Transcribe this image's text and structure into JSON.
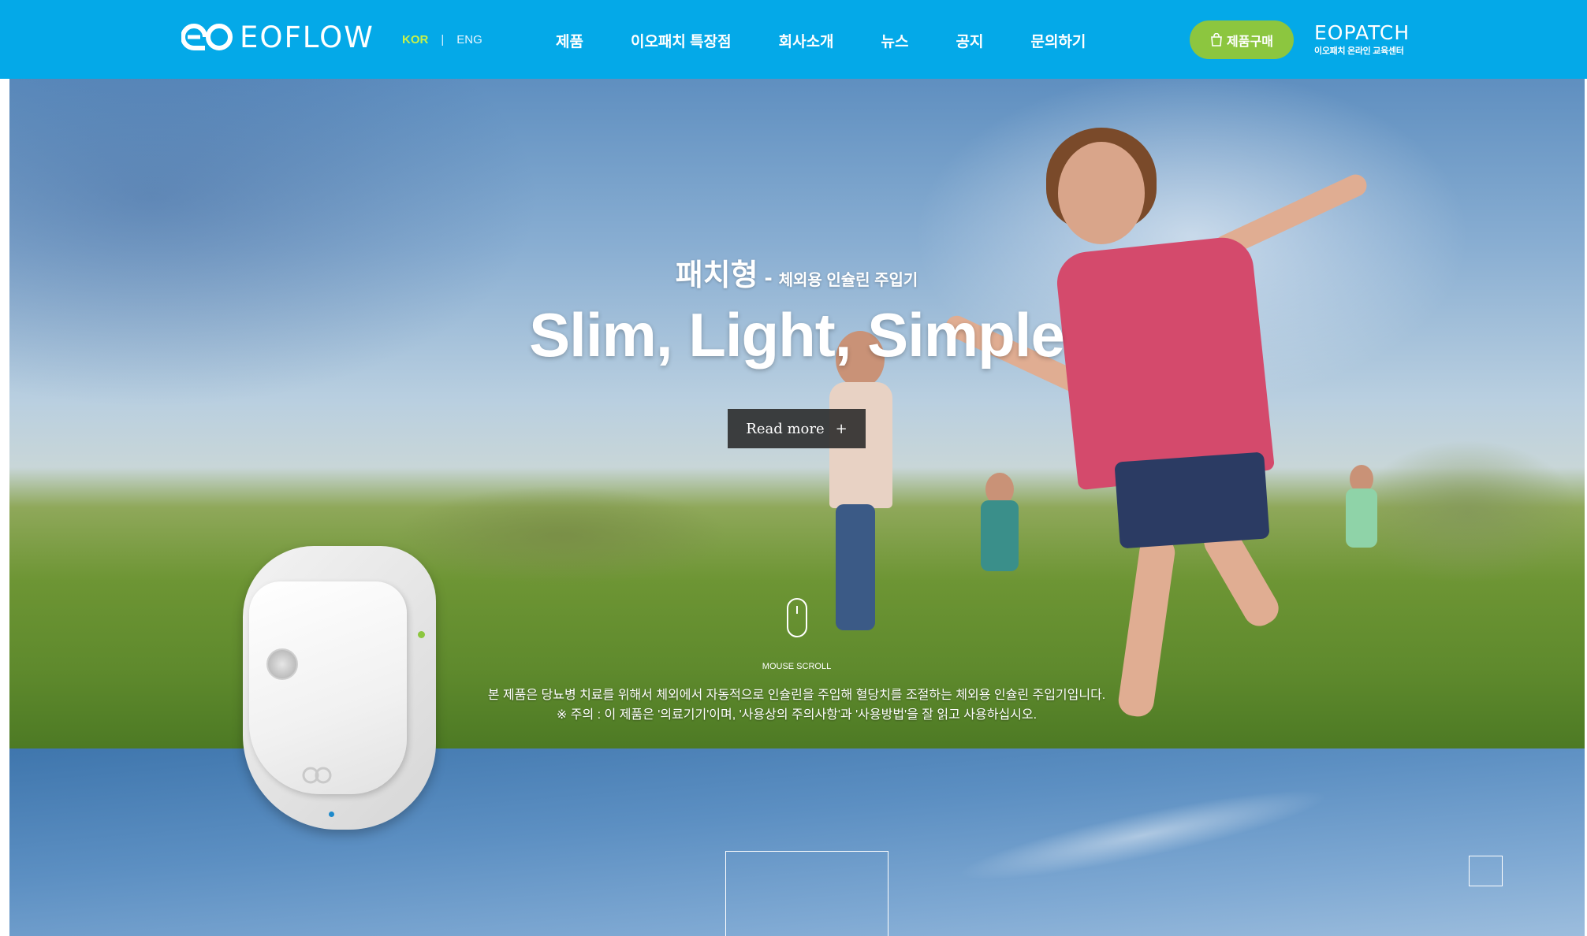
{
  "header": {
    "logo_text": "EOFLOW",
    "lang": {
      "kor": "KOR",
      "separator": "|",
      "eng": "ENG"
    },
    "nav": [
      "제품",
      "이오패치 특장점",
      "회사소개",
      "뉴스",
      "공지",
      "문의하기"
    ],
    "buy_button": "제품구매",
    "eopatch": {
      "brand": "EOPATCH",
      "tagline": "이오패치 온라인 교육센터"
    }
  },
  "hero": {
    "subtitle_main": "패치형",
    "subtitle_dash": "-",
    "subtitle_small": "체외용 인슐린 주입기",
    "title": "Slim, Light, Simple",
    "read_more": "Read more",
    "read_more_icon": "+",
    "scroll_label": "MOUSE SCROLL",
    "description_1": "본 제품은 당뇨병 치료를 위해서 체외에서 자동적으로 인슐린을 주입해 혈당치를 조절하는 체외용 인슐린 주입기입니다.",
    "description_2": "※ 주의 : 이 제품은 '의료기기'이며, '사용상의 주의사항'과 '사용방법'을 잘 읽고 사용하십시오."
  },
  "colors": {
    "header_bg": "#04a9e8",
    "accent_green": "#8cc63f",
    "lang_active": "#c7f14a"
  },
  "icons": {
    "logo": "eoflow-logo-icon",
    "bag": "shopping-bag-icon",
    "mouse": "mouse-scroll-icon"
  }
}
